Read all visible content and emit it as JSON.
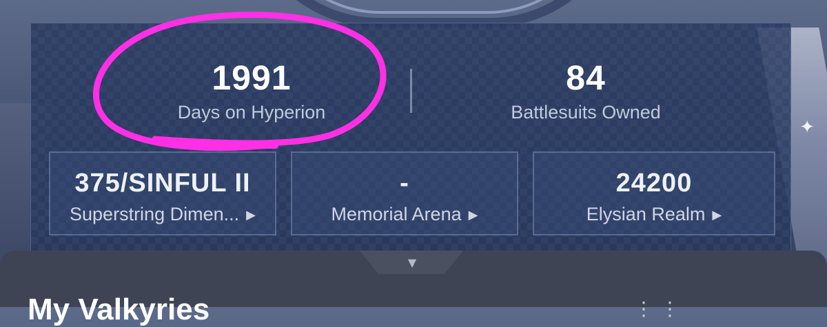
{
  "stats": {
    "days": {
      "value": "1991",
      "label": "Days on Hyperion"
    },
    "battlesuits": {
      "value": "84",
      "label": "Battlesuits Owned"
    }
  },
  "modes": [
    {
      "value": "375/SINFUL II",
      "label": "Superstring Dimen...",
      "arrow_icon": "play-triangle-icon"
    },
    {
      "value": "-",
      "label": "Memorial Arena",
      "arrow_icon": "play-triangle-icon"
    },
    {
      "value": "24200",
      "label": "Elysian Realm",
      "arrow_icon": "play-triangle-icon"
    }
  ],
  "bottom_sheet": {
    "title": "My Valkyries",
    "expand_icon": "chevron-down-icon"
  },
  "colors": {
    "panel": "#26375e",
    "highlight_circle": "#ff2fe6",
    "text_primary": "#ffffff",
    "text_secondary": "#c3cadb",
    "sheet": "#3f4454"
  }
}
